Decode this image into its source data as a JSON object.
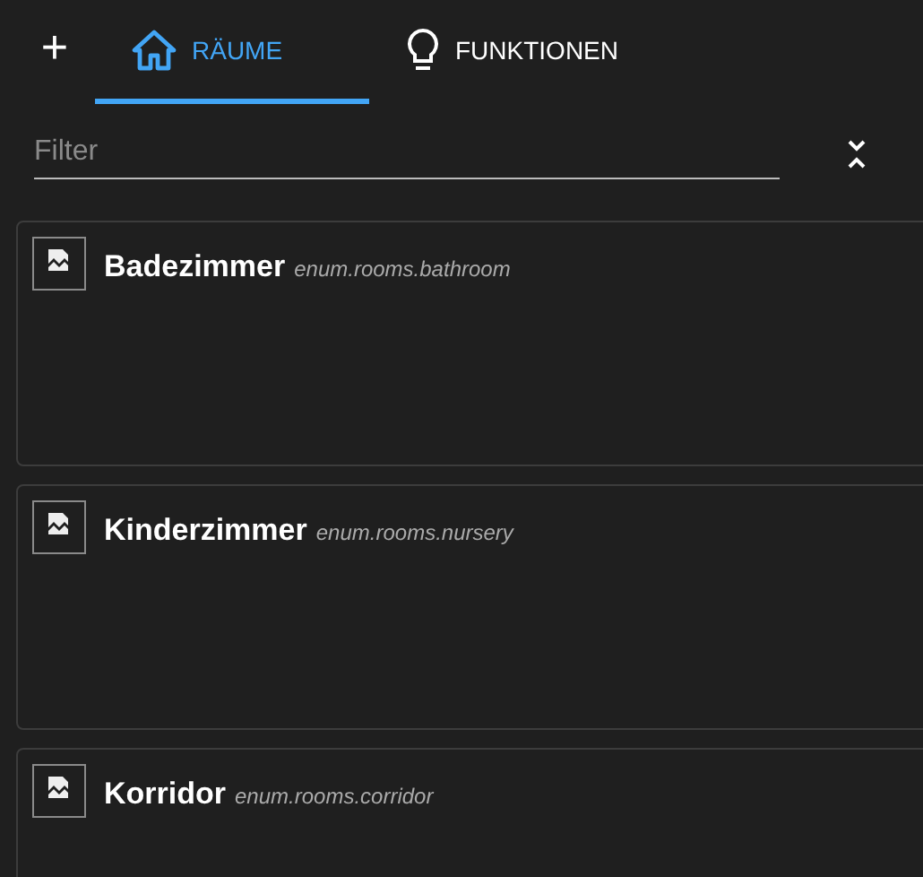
{
  "toolbar": {
    "add_label": "+"
  },
  "tabs": [
    {
      "label": "RÄUME",
      "kind": "home",
      "selected": true
    },
    {
      "label": "FUNKTIONEN",
      "kind": "bulb",
      "selected": false
    }
  ],
  "filter": {
    "placeholder": "Filter"
  },
  "rooms": [
    {
      "name": "Badezimmer",
      "id": "enum.rooms.bathroom"
    },
    {
      "name": "Kinderzimmer",
      "id": "enum.rooms.nursery"
    },
    {
      "name": "Korridor",
      "id": "enum.rooms.corridor"
    }
  ]
}
